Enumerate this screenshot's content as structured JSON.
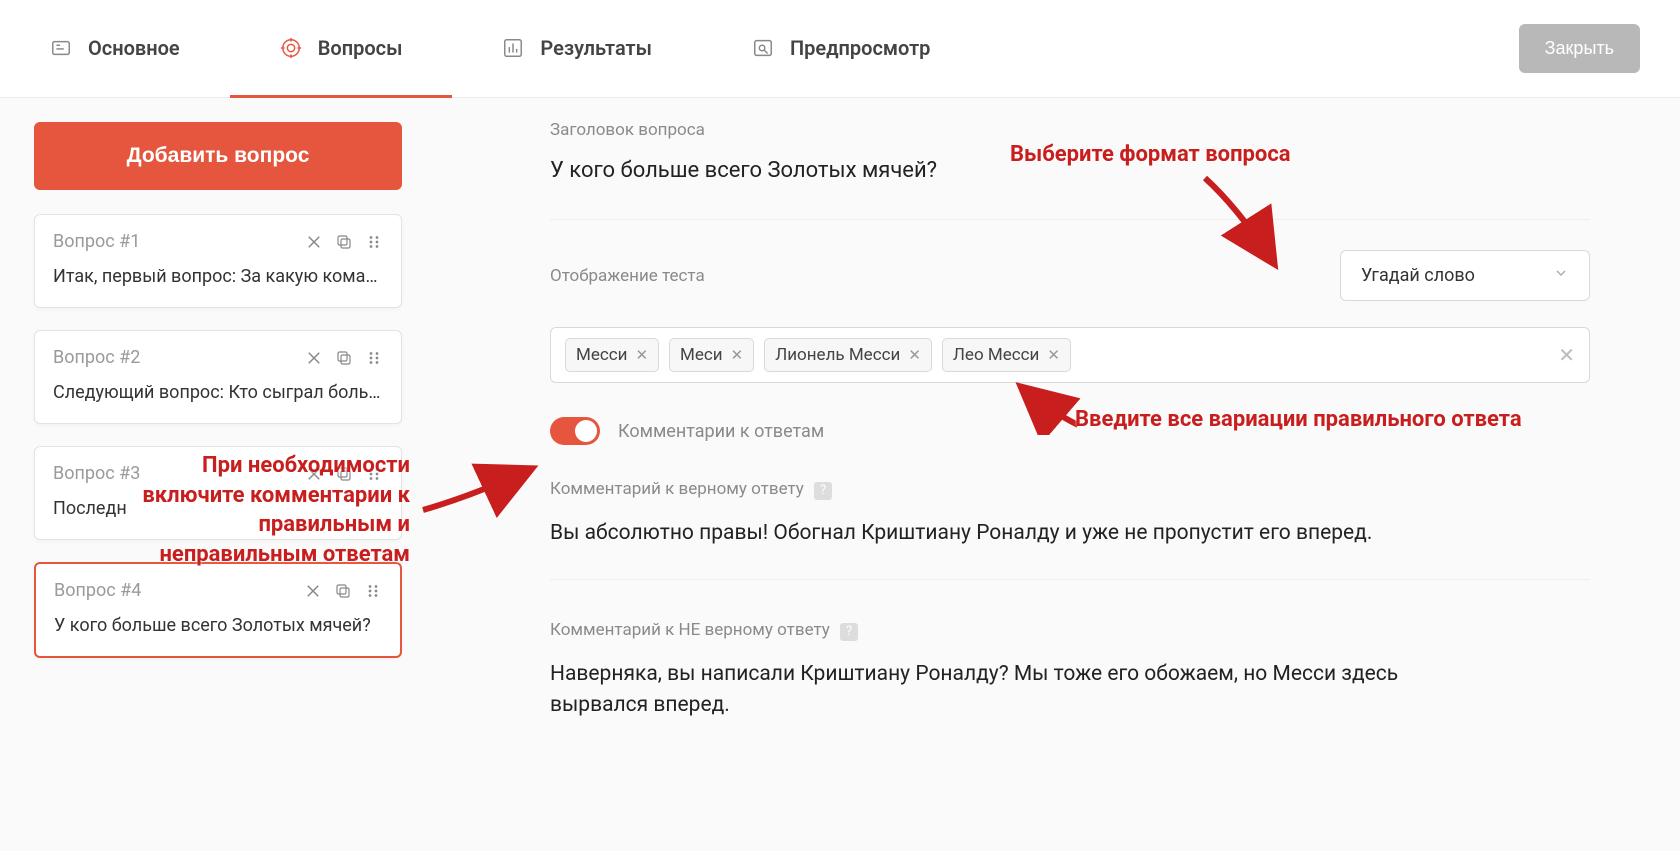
{
  "tabs": {
    "main": "Основное",
    "questions": "Вопросы",
    "results": "Результаты",
    "preview": "Предпросмотр"
  },
  "close_label": "Закрыть",
  "sidebar": {
    "add_button": "Добавить вопрос",
    "items": [
      {
        "num": "Вопрос #1",
        "text": "Итак, первый вопрос: За какую коман…"
      },
      {
        "num": "Вопрос #2",
        "text": "Следующий вопрос: Кто сыграл боль…"
      },
      {
        "num": "Вопрос #3",
        "text": "Последн"
      },
      {
        "num": "Вопрос #4",
        "text": "У кого больше всего Золотых мячей?"
      }
    ]
  },
  "editor": {
    "title_label": "Заголовок вопроса",
    "title_value": "У кого больше всего Золотых мячей?",
    "display_label": "Отображение теста",
    "display_value": "Угадай слово",
    "tags": [
      "Месси",
      "Меси",
      "Лионель Месси",
      "Лео Месси"
    ],
    "comments_toggle_label": "Комментарии к ответам",
    "correct_label": "Комментарий к верному ответу",
    "correct_text": "Вы абсолютно правы! Обогнал Криштиану Роналду и уже не пропустит его вперед.",
    "wrong_label": "Комментарий к НЕ верному ответу",
    "wrong_text": "Наверняка, вы написали Криштиану Роналду? Мы тоже его обожаем, но Месси здесь вырвался вперед."
  },
  "annotations": {
    "format": "Выберите формат вопроса",
    "variants": "Введите все вариации правильного ответа",
    "comments": "При необходимости включите комментарии к правильным и неправильным ответам"
  }
}
